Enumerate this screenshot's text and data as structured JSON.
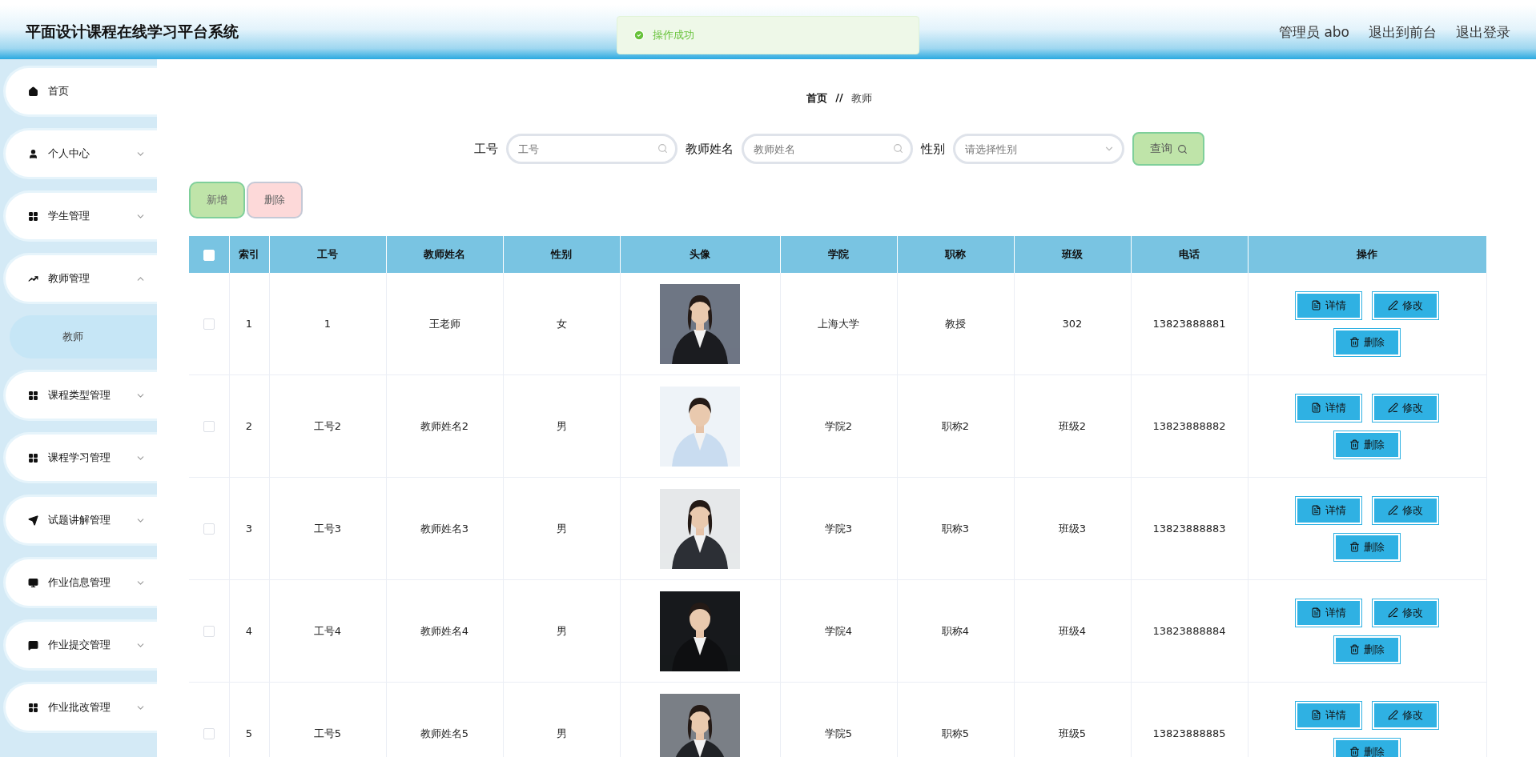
{
  "header": {
    "title": "平面设计课程在线学习平台系统",
    "user": "管理员 abo",
    "links": [
      "退出到前台",
      "退出登录"
    ]
  },
  "toast": {
    "text": "操作成功"
  },
  "sidebar": {
    "items": [
      {
        "label": "首页",
        "kind": "home"
      },
      {
        "label": "个人中心",
        "kind": "user",
        "expandable": true,
        "expanded": false
      },
      {
        "label": "学生管理",
        "kind": "grid",
        "expandable": true,
        "expanded": false
      },
      {
        "label": "教师管理",
        "kind": "chart",
        "expandable": true,
        "expanded": true,
        "children": [
          {
            "label": "教师",
            "selected": true
          }
        ]
      },
      {
        "label": "课程类型管理",
        "kind": "grid",
        "expandable": true,
        "expanded": false
      },
      {
        "label": "课程学习管理",
        "kind": "grid",
        "expandable": true,
        "expanded": false
      },
      {
        "label": "试题讲解管理",
        "kind": "send",
        "expandable": true,
        "expanded": false
      },
      {
        "label": "作业信息管理",
        "kind": "monitor",
        "expandable": true,
        "expanded": false
      },
      {
        "label": "作业提交管理",
        "kind": "message",
        "expandable": true,
        "expanded": false
      },
      {
        "label": "作业批改管理",
        "kind": "grid",
        "expandable": true,
        "expanded": false
      }
    ]
  },
  "breadcrumb": [
    "首页",
    "//",
    "教师"
  ],
  "search": {
    "fields": [
      {
        "label": "工号",
        "kind": "text",
        "placeholder": "工号"
      },
      {
        "label": "教师姓名",
        "kind": "text",
        "placeholder": "教师姓名"
      },
      {
        "label": "性别",
        "kind": "select",
        "placeholder": "请选择性别"
      }
    ],
    "button": "查询"
  },
  "actions": [
    {
      "label": "新增",
      "kind": "add"
    },
    {
      "label": "删除",
      "kind": "delete"
    }
  ],
  "table": {
    "columns": [
      "索引",
      "工号",
      "教师姓名",
      "性别",
      "头像",
      "学院",
      "职称",
      "班级",
      "电话",
      "操作"
    ],
    "all_checked": false,
    "rows": [
      {
        "checked": false,
        "cells": [
          "1",
          "1",
          "王老师",
          "女"
        ],
        "photo": {
          "kind": "picture"
        },
        "rest": [
          "上海大学",
          "教授",
          "302",
          "13823888881"
        ],
        "actions": [
          "详情",
          "修改",
          "删除"
        ]
      },
      {
        "checked": false,
        "cells": [
          "2",
          "工号2",
          "教师姓名2",
          "男"
        ],
        "photo": {
          "kind": "picture"
        },
        "rest": [
          "学院2",
          "职称2",
          "班级2",
          "13823888882"
        ],
        "actions": [
          "详情",
          "修改",
          "删除"
        ]
      },
      {
        "checked": false,
        "cells": [
          "3",
          "工号3",
          "教师姓名3",
          "男"
        ],
        "photo": {
          "kind": "picture"
        },
        "rest": [
          "学院3",
          "职称3",
          "班级3",
          "13823888883"
        ],
        "actions": [
          "详情",
          "修改",
          "删除"
        ]
      },
      {
        "checked": false,
        "cells": [
          "4",
          "工号4",
          "教师姓名4",
          "男"
        ],
        "photo": {
          "kind": "picture"
        },
        "rest": [
          "学院4",
          "职称4",
          "班级4",
          "13823888884"
        ],
        "actions": [
          "详情",
          "修改",
          "删除"
        ]
      },
      {
        "checked": false,
        "cells": [
          "5",
          "工号5",
          "教师姓名5",
          "男"
        ],
        "photo": {
          "kind": "picture"
        },
        "rest": [
          "学院5",
          "职称5",
          "班级5",
          "13823888885"
        ],
        "actions": [
          "详情",
          "修改",
          "删除"
        ]
      }
    ]
  }
}
